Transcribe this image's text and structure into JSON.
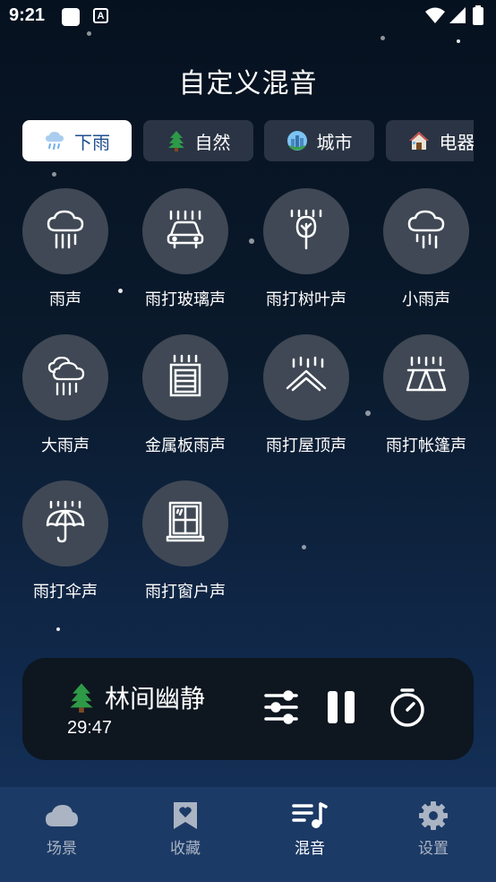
{
  "status_bar": {
    "time": "9:21",
    "notification_letter": "A"
  },
  "page": {
    "title": "自定义混音"
  },
  "tabs": [
    {
      "label": "下雨",
      "icon": "rain-cloud-icon",
      "active": true
    },
    {
      "label": "自然",
      "icon": "pine-tree-icon",
      "active": false
    },
    {
      "label": "城市",
      "icon": "city-globe-icon",
      "active": false
    },
    {
      "label": "电器",
      "icon": "house-icon",
      "active": false
    }
  ],
  "sounds": [
    {
      "label": "雨声",
      "icon": "rain-cloud-icon"
    },
    {
      "label": "雨打玻璃声",
      "icon": "car-rain-icon"
    },
    {
      "label": "雨打树叶声",
      "icon": "tree-rain-icon"
    },
    {
      "label": "小雨声",
      "icon": "light-rain-icon"
    },
    {
      "label": "大雨声",
      "icon": "heavy-rain-icon"
    },
    {
      "label": "金属板雨声",
      "icon": "metal-sheet-rain-icon"
    },
    {
      "label": "雨打屋顶声",
      "icon": "roof-rain-icon"
    },
    {
      "label": "雨打帐篷声",
      "icon": "tent-rain-icon"
    },
    {
      "label": "雨打伞声",
      "icon": "umbrella-rain-icon"
    },
    {
      "label": "雨打窗户声",
      "icon": "window-rain-icon"
    }
  ],
  "player": {
    "title": "林间幽静",
    "time": "29:47",
    "emoji": "🌲"
  },
  "nav": [
    {
      "label": "场景",
      "icon": "cloud-icon",
      "active": false
    },
    {
      "label": "收藏",
      "icon": "bookmark-heart-icon",
      "active": false
    },
    {
      "label": "混音",
      "icon": "playlist-music-icon",
      "active": true
    },
    {
      "label": "设置",
      "icon": "gear-icon",
      "active": false
    }
  ]
}
